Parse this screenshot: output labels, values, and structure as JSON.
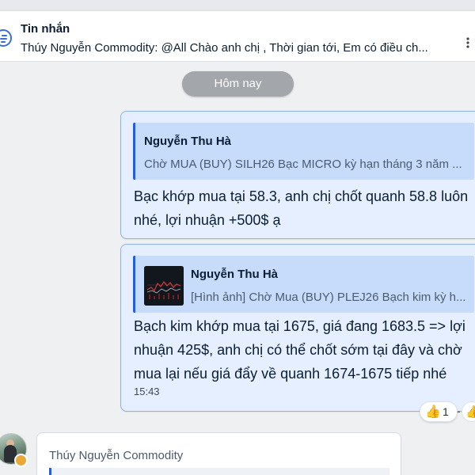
{
  "pinned": {
    "title": "Tin nhắn",
    "text": "Thúy Nguyễn Commodity: @All Chào anh chị , Thời gian tới, Em có điều ch..."
  },
  "date_divider": "Hôm nay",
  "messages": [
    {
      "quote_name": "Nguyễn Thu Hà",
      "quote_text": "Chờ MUA (BUY) SILH26 Bạc MICRO kỳ hạn tháng 3 năm ...",
      "body": "Bạc khớp mua tại 58.3, anh chị chốt quanh 58.8 luôn nhé, lợi nhuận +500$ ạ"
    },
    {
      "quote_name": "Nguyễn Thu Hà",
      "quote_text": "[Hình ảnh] Chờ Mua (BUY) PLEJ26 Bạch kim kỳ h...",
      "body": "Bạch kim khớp mua tại 1675, giá đang 1683.5 => lợi nhuận 425$, anh chị có thể chốt sớm tại đây và chờ mua lại nếu giá đẩy về quanh 1674-1675 tiếp nhé",
      "time": "15:43",
      "reaction": {
        "icon": "thumbs-up-icon",
        "count": "1"
      }
    }
  ],
  "incoming": {
    "sender": "Thúy Nguyễn Commodity"
  },
  "colors": {
    "bubble_bg": "#e5efff",
    "quote_bg": "#c7dcfb",
    "accent": "#1b60e8",
    "date_chip": "#a3a6ab"
  }
}
